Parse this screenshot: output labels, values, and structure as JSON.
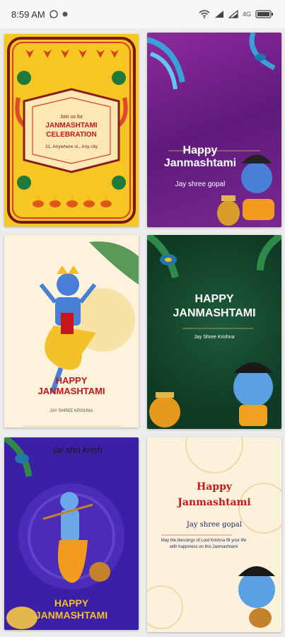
{
  "status_bar": {
    "time": "8:59 AM",
    "battery": "100",
    "network": "4G"
  },
  "cards": [
    {
      "line1": "Join us for",
      "title": "JANMASHTAMI",
      "subtitle": "CELEBRATION",
      "address": "21, Anywhere st., Any city"
    },
    {
      "title_line1": "Happy",
      "title_line2": "Janmashtami",
      "subtitle": "Jay shree gopal"
    },
    {
      "title_line1": "HAPPY",
      "title_line2": "JANMASHTAMI",
      "subtitle": "JAY SHREE KRISHNA"
    },
    {
      "title_line1": "HAPPY",
      "title_line2": "JANMASHTAMI",
      "subtitle": "Jay Shree Krishna"
    },
    {
      "top_text": "jai shri krish",
      "title_line1": "HAPPY",
      "title_line2": "JANMASHTAMI"
    },
    {
      "title_line1": "Happy",
      "title_line2": "Janmashtami",
      "subtitle": "Jay shree gopal",
      "message": "May the blessings of Lord Krishna fill your life with happiness on this Janmashtami"
    }
  ],
  "colors": {
    "card1_bg": "#f6c623",
    "card2_bg": "#7a2890",
    "card4_bg": "#0f3b25",
    "card5_bg": "#3b1fa6",
    "red_title": "#c4161c"
  }
}
